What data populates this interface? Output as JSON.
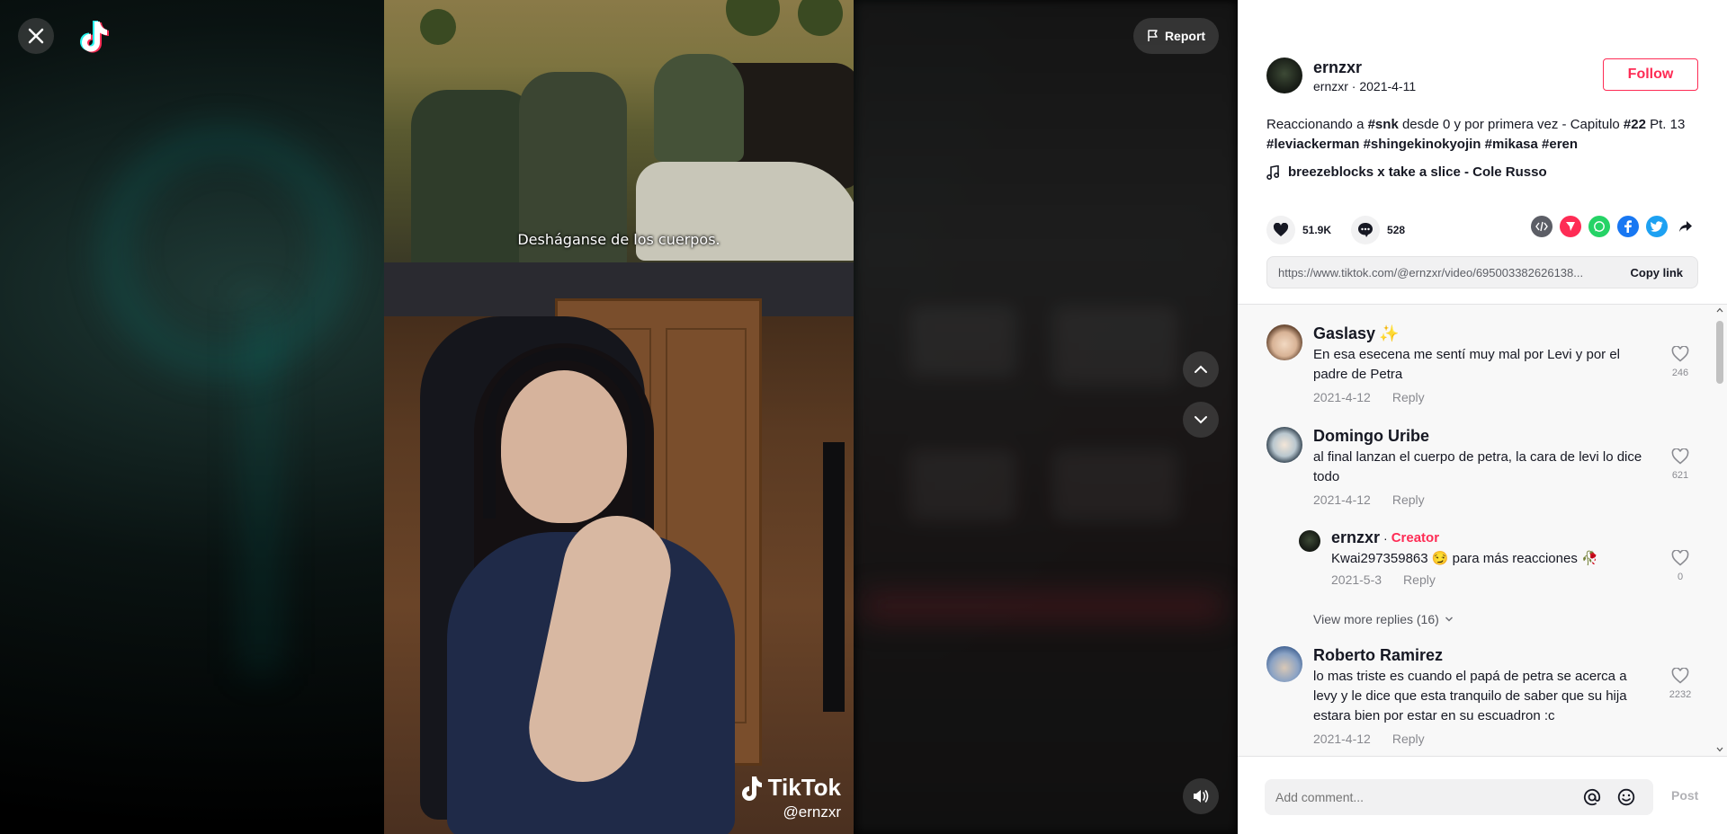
{
  "topbar": {
    "close_icon": "close-icon",
    "logo_icon": "tiktok-logo-icon",
    "report_label": "Report"
  },
  "video": {
    "subtitle": "Desháganse de los cuerpos.",
    "watermark_brand": "TikTok",
    "watermark_handle": "@ernzxr"
  },
  "author": {
    "username": "ernzxr",
    "subline": "ernzxr · 2021-4-11",
    "follow_label": "Follow"
  },
  "caption": {
    "parts": [
      {
        "text": "Reaccionando a ",
        "bold": false
      },
      {
        "text": "#snk",
        "bold": true
      },
      {
        "text": " desde 0 y por primera vez - Capitulo ",
        "bold": false
      },
      {
        "text": "#22",
        "bold": true
      },
      {
        "text": " Pt. 13 ",
        "bold": false
      },
      {
        "text": "#leviackerman",
        "bold": true
      },
      {
        "text": " ",
        "bold": false
      },
      {
        "text": "#shingekinokyojin",
        "bold": true
      },
      {
        "text": " ",
        "bold": false
      },
      {
        "text": "#mikasa",
        "bold": true
      },
      {
        "text": " ",
        "bold": false
      },
      {
        "text": "#eren",
        "bold": true
      }
    ]
  },
  "music": {
    "title": "breezeblocks x take a slice - Cole Russo"
  },
  "stats": {
    "likes": "51.9K",
    "comments": "528"
  },
  "share": {
    "link": "https://www.tiktok.com/@ernzxr/video/695003382626138...",
    "copy_label": "Copy link",
    "icons": [
      "embed-icon",
      "send-to-friends-icon",
      "whatsapp-icon",
      "facebook-icon",
      "twitter-icon",
      "share-arrow-icon"
    ]
  },
  "comments": [
    {
      "name": "Gaslasy",
      "name_emoji": "✨",
      "text": "En esa esecena me sentí muy mal por Levi y por el padre de Petra",
      "date": "2021-4-12",
      "reply": "Reply",
      "likes": "246"
    },
    {
      "name": "Domingo Uribe",
      "text": "al final lanzan el cuerpo de petra, la cara de levi lo dice todo",
      "date": "2021-4-12",
      "reply": "Reply",
      "likes": "621"
    },
    {
      "name": "Roberto Ramirez",
      "text": "lo mas triste es cuando el papá de petra se acerca a levy y le dice que esta tranquilo de saber que su hija estara bien por estar en su escuadron :c",
      "date": "2021-4-12",
      "reply": "Reply",
      "likes": "2232"
    }
  ],
  "reply": {
    "name": "ernzxr",
    "dot": "·",
    "badge": "Creator",
    "text": "Kwai297359863 😏 para más reacciones 🥀",
    "date": "2021-5-3",
    "reply": "Reply",
    "likes": "0"
  },
  "view_more": "View more replies (16)",
  "composer": {
    "placeholder": "Add comment...",
    "post_label": "Post"
  },
  "colors": {
    "accent": "#fe2c55",
    "text": "#161823",
    "whatsapp": "#25d366",
    "facebook": "#1877f2",
    "twitter": "#1da1f2"
  }
}
